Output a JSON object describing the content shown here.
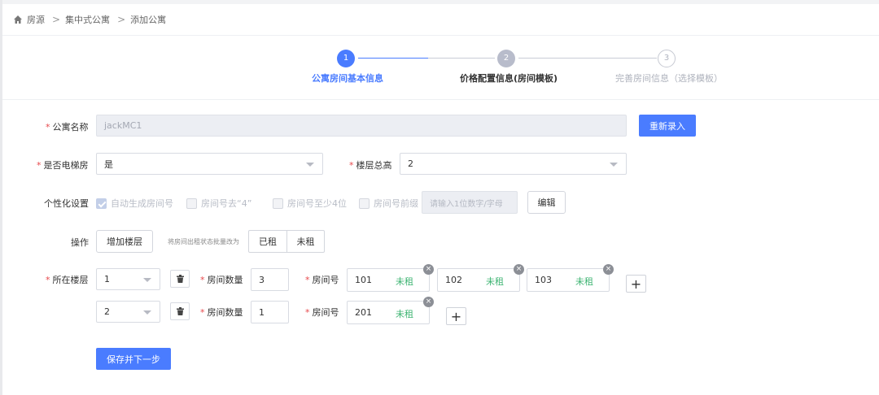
{
  "breadcrumb": {
    "items": [
      "房源",
      "集中式公寓",
      "添加公寓"
    ],
    "separator": ">"
  },
  "steps": [
    {
      "num": "1",
      "label": "公寓房间基本信息",
      "state": "active"
    },
    {
      "num": "2",
      "label": "价格配置信息(房间模板)",
      "state": "current"
    },
    {
      "num": "3",
      "label": "完善房间信息（选择模板）",
      "state": "todo"
    }
  ],
  "form": {
    "name_label": "公寓名称",
    "name_value": "jackMC1",
    "reenter_button": "重新录入",
    "elevator_label": "是否电梯房",
    "elevator_value": "是",
    "floors_label": "楼层总高",
    "floors_value": "2",
    "personal_label": "个性化设置",
    "options": {
      "auto": "自动生成房间号",
      "no_four": "房间号去“4”",
      "min_four": "房间号至少4位",
      "prefix": "房间号前缀"
    },
    "prefix_placeholder": "请输入1位数字/字母",
    "edit_button": "编辑",
    "ops_label": "操作",
    "add_floor_button": "增加楼层",
    "batch_note": "将房间出租状态批量改为",
    "rented": "已租",
    "unrented": "未租",
    "floor_label": "所在楼层",
    "room_count_label": "房间数量",
    "room_no_label": "房间号",
    "floors": [
      {
        "floor": "1",
        "count": "3",
        "rooms": [
          {
            "num": "101",
            "status": "未租"
          },
          {
            "num": "102",
            "status": "未租"
          },
          {
            "num": "103",
            "status": "未租"
          }
        ]
      },
      {
        "floor": "2",
        "count": "1",
        "rooms": [
          {
            "num": "201",
            "status": "未租"
          }
        ]
      }
    ],
    "plus": "+",
    "remove_mark": "×",
    "save_button": "保存并下一步"
  },
  "colors": {
    "primary": "#4a7cff",
    "required": "#e7484b",
    "unrented": "#3cb371"
  }
}
